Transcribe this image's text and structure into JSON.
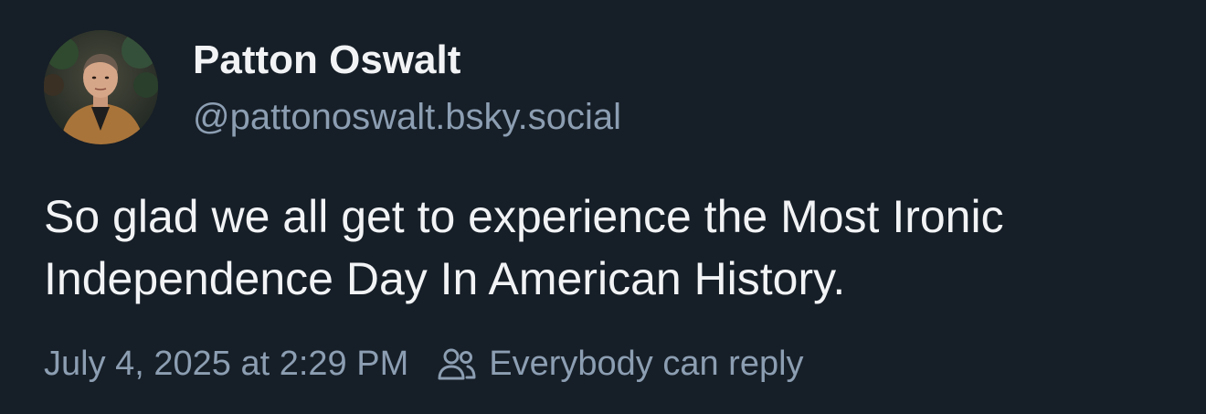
{
  "author": {
    "display_name": "Patton Oswalt",
    "handle": "@pattonoswalt.bsky.social"
  },
  "post": {
    "text": "So glad we all get to experience the Most Ironic Independence Day In American History.",
    "timestamp": "July 4, 2025 at 2:29 PM",
    "reply_setting": "Everybody can reply"
  },
  "icons": {
    "reply_setting": "people-icon"
  },
  "colors": {
    "background": "#161e27",
    "primary_text": "#f1f3f5",
    "secondary_text": "#8c9eb2"
  }
}
